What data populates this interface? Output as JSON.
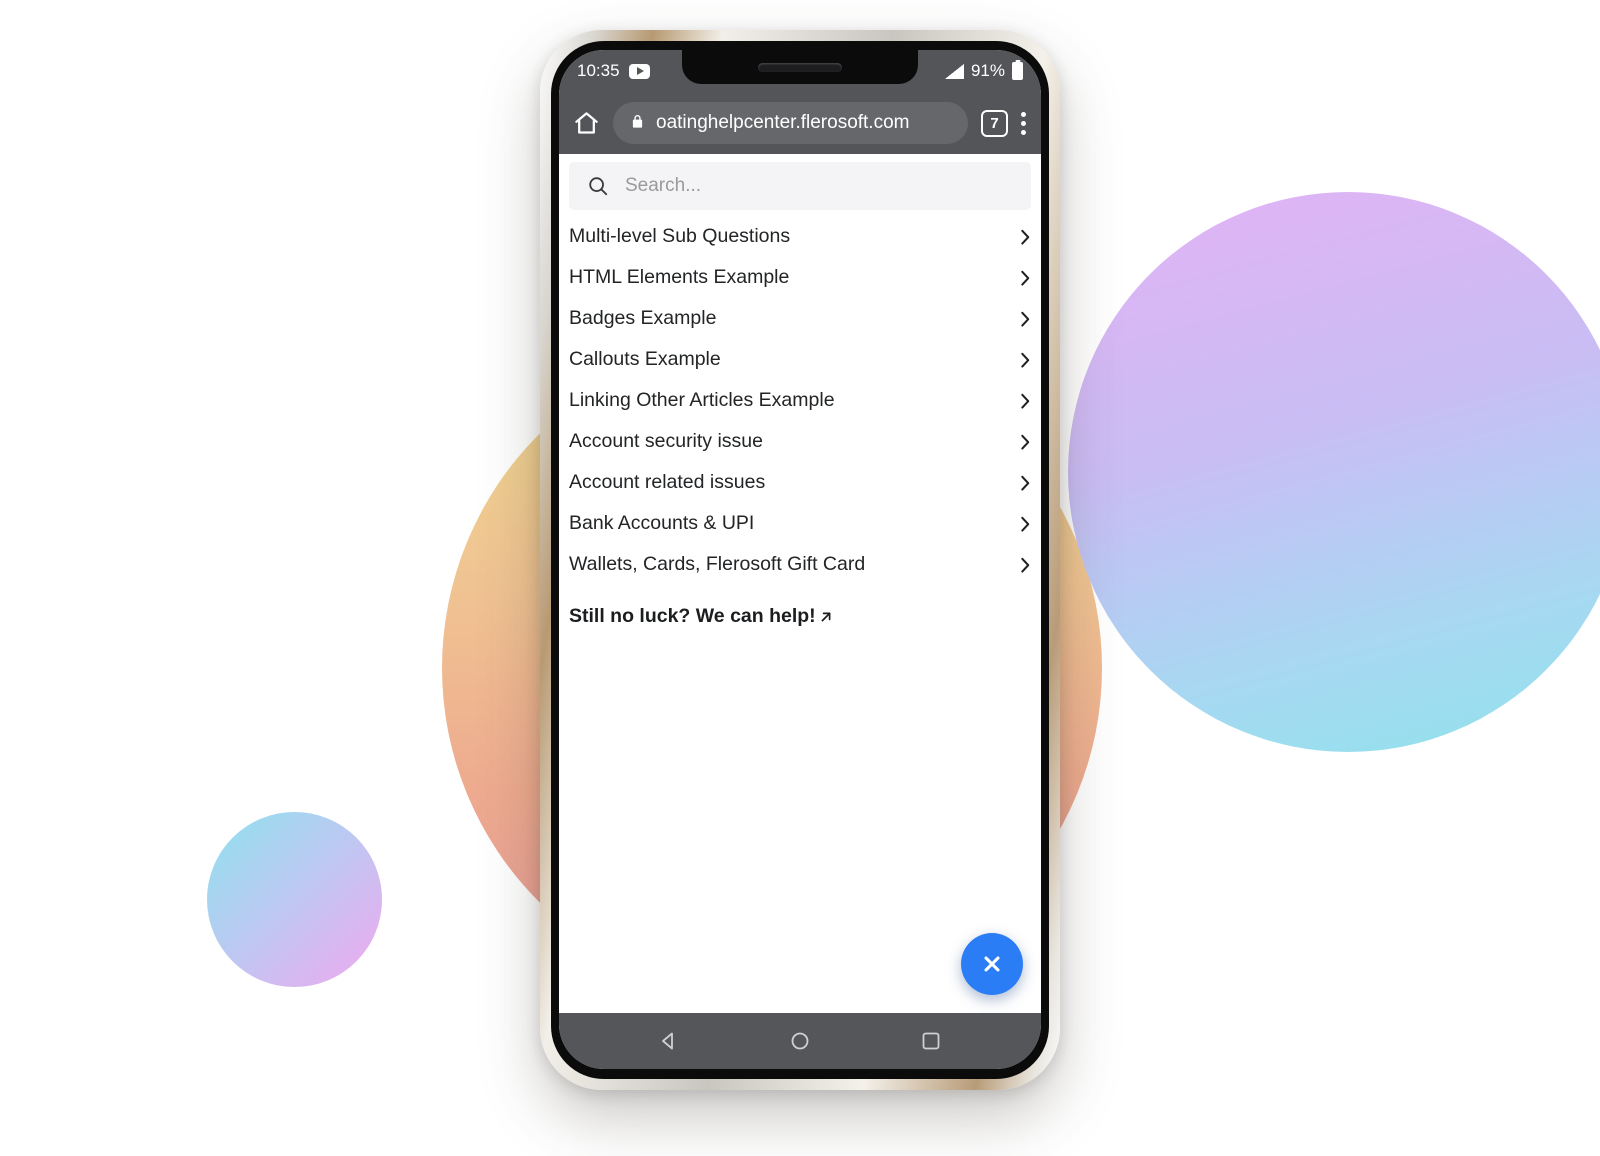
{
  "background": {
    "blobs": [
      {
        "name": "warm-gradient-circle",
        "colors": [
          "#efd98f",
          "#eeab8f",
          "#e89a9a"
        ]
      },
      {
        "name": "cool-gradient-circle",
        "colors": [
          "#e3b2f5",
          "#a8d8f2",
          "#8fe3ec"
        ]
      },
      {
        "name": "small-gradient-circle",
        "colors": [
          "#8fe2ee",
          "#f0a8ee"
        ]
      }
    ]
  },
  "device": {
    "status_bar": {
      "time": "10:35",
      "media_icon": "youtube-icon",
      "signal_icon": "signal-icon",
      "battery_percent": "91%",
      "battery_icon": "battery-icon"
    },
    "browser": {
      "home_icon": "home-icon",
      "lock_icon": "lock-icon",
      "url": "oatinghelpcenter.flerosoft.com",
      "tab_count": "7",
      "menu_icon": "overflow-menu-icon"
    },
    "nav_bar": {
      "back_label": "Back",
      "home_label": "Home",
      "recents_label": "Recent apps"
    }
  },
  "search": {
    "icon": "search-icon",
    "placeholder": "Search...",
    "value": ""
  },
  "list": {
    "chevron_icon": "chevron-right-icon",
    "items": [
      {
        "label": "Multi-level Sub Questions"
      },
      {
        "label": "HTML Elements Example"
      },
      {
        "label": "Badges Example"
      },
      {
        "label": "Callouts Example"
      },
      {
        "label": "Linking Other Articles Example"
      },
      {
        "label": "Account security issue"
      },
      {
        "label": "Account related issues"
      },
      {
        "label": "Bank Accounts & UPI"
      },
      {
        "label": "Wallets, Cards, Flerosoft Gift Card"
      }
    ]
  },
  "help": {
    "text": "Still no luck? We can help!",
    "arrow_icon": "arrow-up-right-icon"
  },
  "fab": {
    "icon": "close-icon",
    "label": "Close",
    "color": "#2b7df5"
  }
}
